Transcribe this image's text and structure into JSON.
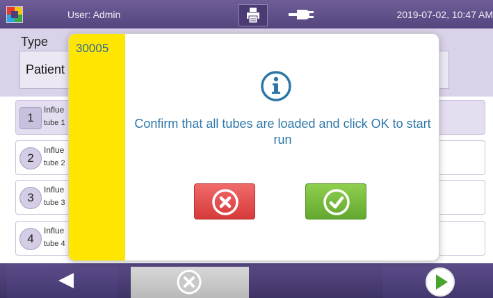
{
  "topbar": {
    "user_label": "User: Admin",
    "datetime": "2019-07-02, 10:47 AM",
    "icons": {
      "logo": "app-logo",
      "print": "printer-icon",
      "power": "power-plug-icon"
    }
  },
  "main": {
    "type_label": "Type",
    "patient_label": "Patient",
    "tubes": [
      {
        "number": "1",
        "name": "Influe",
        "sub": "tube 1"
      },
      {
        "number": "2",
        "name": "Influe",
        "sub": "tube 2"
      },
      {
        "number": "3",
        "name": "Influe",
        "sub": "tube 3"
      },
      {
        "number": "4",
        "name": "Influe",
        "sub": "tube 4"
      }
    ]
  },
  "modal": {
    "code": "30005",
    "message": "Confirm that all tubes are loaded and click OK to start run",
    "icon": "info-icon",
    "cancel_icon": "close-circle-icon",
    "ok_icon": "check-circle-icon",
    "colors": {
      "stripe": "#ffe600",
      "cancel": "#e04848",
      "ok": "#79bd3c",
      "text": "#2d77a8"
    }
  },
  "bottombar": {
    "icons": {
      "back": "back-arrow-icon",
      "cancel": "cancel-circle-icon",
      "next": "play-next-icon"
    }
  },
  "colors": {
    "bar": "#55457e",
    "panel": "#d9d2e8"
  }
}
